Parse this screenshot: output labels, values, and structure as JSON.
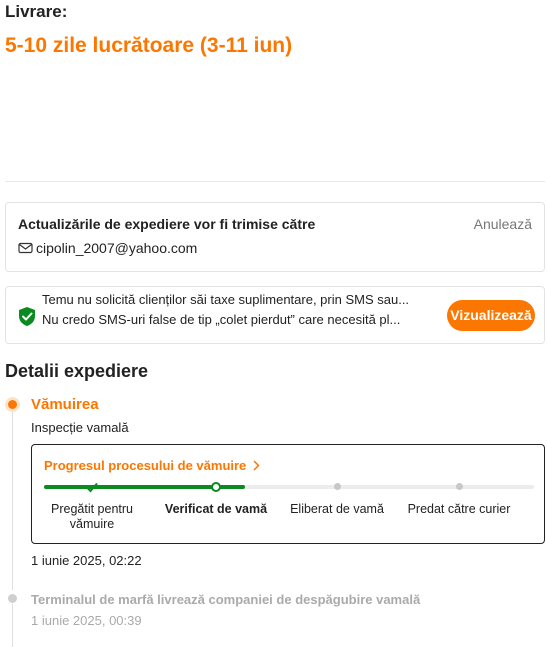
{
  "delivery": {
    "label": "Livrare:",
    "time": "5-10 zile lucrătoare (3-11 iun)"
  },
  "notification": {
    "title": "Actualizările de expediere vor fi trimise către",
    "cancel_label": "Anulează",
    "email": "cipolin_2007@yahoo.com"
  },
  "security": {
    "line1": "Temu nu solicită clienților săi taxe suplimentare, prin SMS sau...",
    "line2": "Nu credo SMS-uri false de tip „colet pierdut” care necesită pl...",
    "button_label": "Vizualizează",
    "accent_color": "#fb7701",
    "shield_color": "#0a8a1f"
  },
  "details": {
    "title": "Detalii expediere",
    "events": [
      {
        "title": "Vămuirea",
        "description": "Inspecție vamală",
        "time": "1 iunie 2025, 02:22",
        "status": "active"
      },
      {
        "title": "Terminalul de marfă livrează companiei de despăgubire vamală",
        "time": "1 iunie 2025, 00:39",
        "status": "past"
      }
    ],
    "progress": {
      "title": "Progresul procesului de vămuire",
      "completed_fraction": 0.41,
      "steps": [
        {
          "label": "Pregătit pentru vămuire",
          "state": "done"
        },
        {
          "label": "Verificat de vamă",
          "state": "current"
        },
        {
          "label": "Eliberat de vamă",
          "state": "future"
        },
        {
          "label": "Predat către curier",
          "state": "future"
        }
      ]
    }
  }
}
